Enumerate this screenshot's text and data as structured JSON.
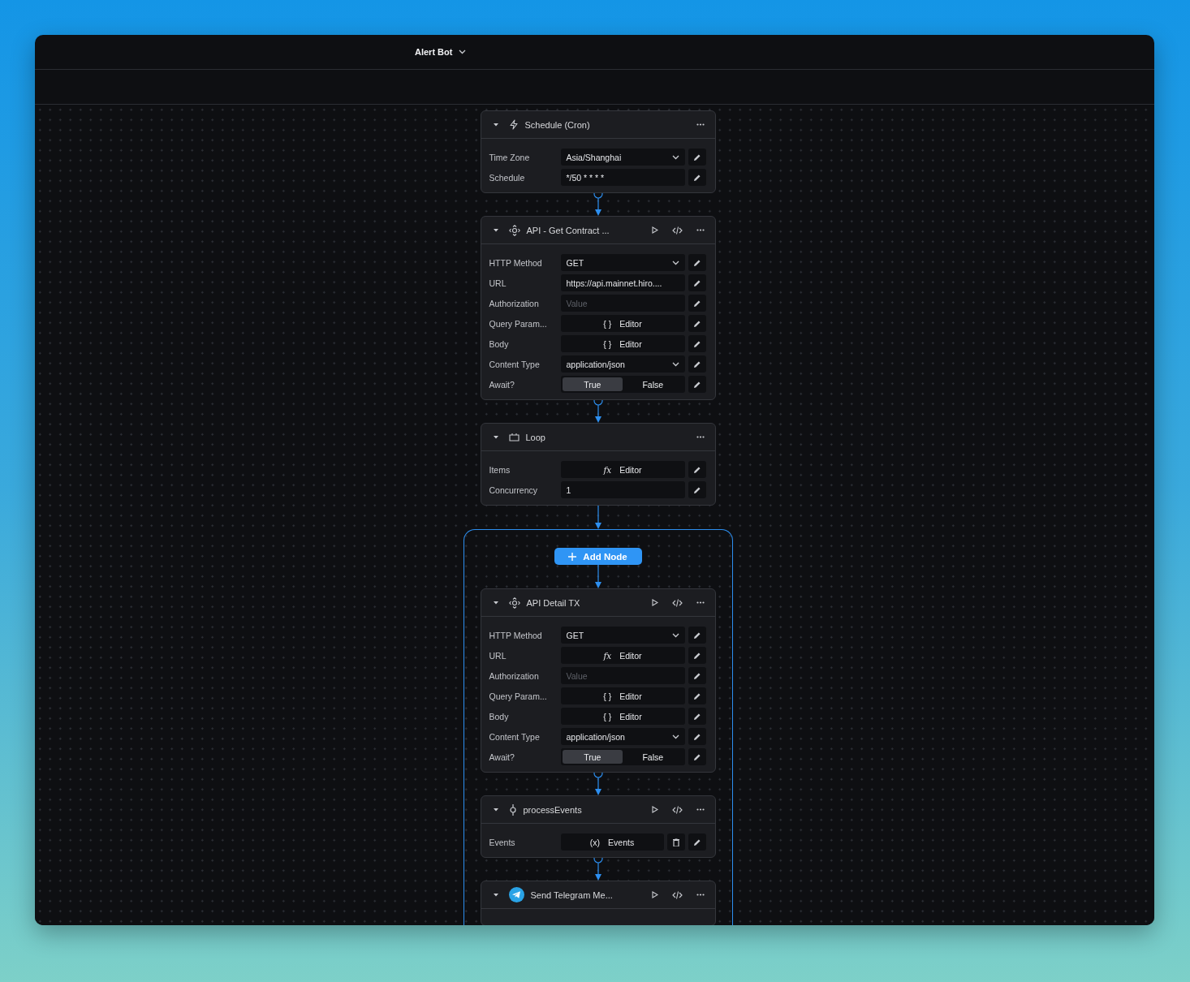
{
  "workflow": {
    "title": "Alert Bot"
  },
  "nodes": [
    {
      "kind": "trigger",
      "title": "Schedule (Cron)",
      "runnable": false,
      "fields": [
        {
          "label": "Time Zone",
          "kind": "select",
          "value": "Asia/Shanghai"
        },
        {
          "label": "Schedule",
          "kind": "text",
          "value": "*/50 * * * *"
        }
      ]
    },
    {
      "kind": "api",
      "title": "API - Get Contract ...",
      "runnable": true,
      "fields": [
        {
          "label": "HTTP Method",
          "kind": "select",
          "value": "GET"
        },
        {
          "label": "URL",
          "kind": "text",
          "value": "https://api.mainnet.hiro...."
        },
        {
          "label": "Authorization",
          "kind": "input",
          "placeholder": "Value"
        },
        {
          "label": "Query Param...",
          "kind": "editor",
          "badge": "{ }",
          "value": "Editor"
        },
        {
          "label": "Body",
          "kind": "editor",
          "badge": "{ }",
          "value": "Editor"
        },
        {
          "label": "Content Type",
          "kind": "select",
          "value": "application/json"
        },
        {
          "label": "Await?",
          "kind": "toggle",
          "options": [
            {
              "label": "True",
              "selected": true
            },
            {
              "label": "False",
              "selected": false
            }
          ]
        }
      ]
    },
    {
      "kind": "loop",
      "title": "Loop",
      "runnable": false,
      "fields": [
        {
          "label": "Items",
          "kind": "editor",
          "badge": "fx",
          "value": "Editor"
        },
        {
          "label": "Concurrency",
          "kind": "text",
          "value": "1"
        }
      ],
      "body": {
        "add_button": "Add Node",
        "nodes": [
          {
            "kind": "api",
            "title": "API Detail TX",
            "runnable": true,
            "fields": [
              {
                "label": "HTTP Method",
                "kind": "select",
                "value": "GET"
              },
              {
                "label": "URL",
                "kind": "editor",
                "badge": "fx",
                "value": "Editor"
              },
              {
                "label": "Authorization",
                "kind": "input",
                "placeholder": "Value"
              },
              {
                "label": "Query Param...",
                "kind": "editor",
                "badge": "{ }",
                "value": "Editor"
              },
              {
                "label": "Body",
                "kind": "editor",
                "badge": "{ }",
                "value": "Editor"
              },
              {
                "label": "Content Type",
                "kind": "select",
                "value": "application/json"
              },
              {
                "label": "Await?",
                "kind": "toggle",
                "options": [
                  {
                    "label": "True",
                    "selected": true
                  },
                  {
                    "label": "False",
                    "selected": false
                  }
                ]
              }
            ]
          },
          {
            "kind": "code",
            "title": "processEvents",
            "runnable": true,
            "fields": [
              {
                "label": "Events",
                "kind": "editor",
                "badge": "(x)",
                "value": "Events",
                "deletable": true
              }
            ]
          },
          {
            "kind": "telegram",
            "title": "Send Telegram Me...",
            "runnable": true
          }
        ]
      }
    }
  ]
}
